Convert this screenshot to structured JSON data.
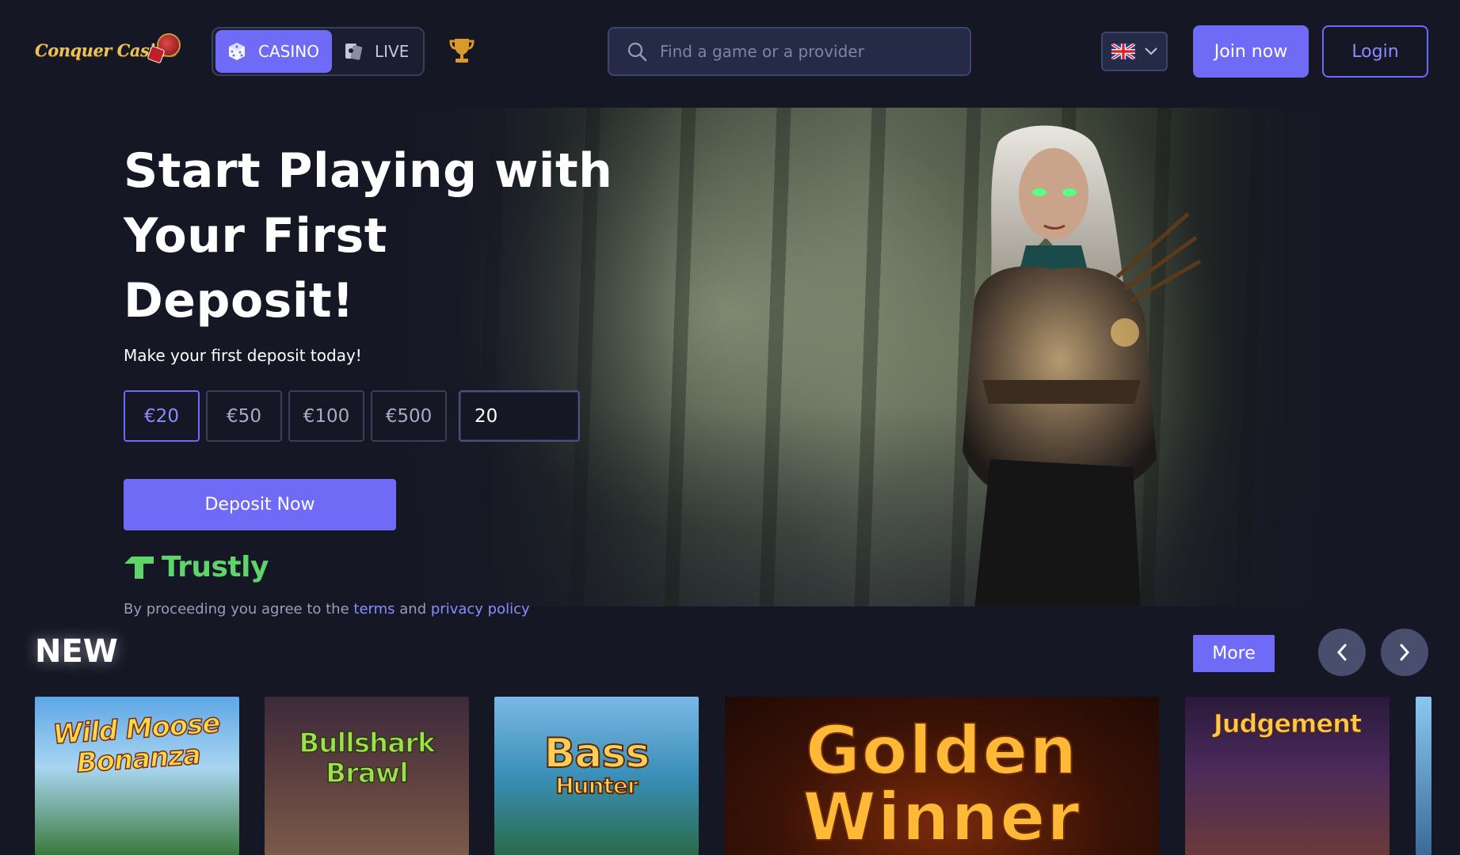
{
  "header": {
    "logo_text": "Conquer Casino",
    "mode_tabs": [
      {
        "label": "CASINO",
        "icon": "dice-icon",
        "active": true
      },
      {
        "label": "LIVE",
        "icon": "cards-icon",
        "active": false
      }
    ],
    "trophy_icon": "trophy-icon",
    "search": {
      "placeholder": "Find a game or a provider",
      "icon": "search-icon"
    },
    "language": {
      "flag": "uk-flag-icon",
      "icon": "chevron-down-icon"
    },
    "join_label": "Join now",
    "login_label": "Login"
  },
  "hero": {
    "title_line1": "Start Playing with",
    "title_line2": "Your First Deposit!",
    "subtitle": "Make your first deposit today!",
    "amounts": [
      "€20",
      "€50",
      "€100",
      "€500"
    ],
    "selected_amount": "€20",
    "amount_value": "20",
    "deposit_label": "Deposit Now",
    "payment_provider": "Trustly",
    "legal": {
      "prefix": "By proceeding you agree to the",
      "terms_link": "terms",
      "conjunction": "and",
      "privacy_link": "privacy policy"
    }
  },
  "new_section": {
    "title": "NEW",
    "more_label": "More",
    "prev_icon": "chevron-left-icon",
    "next_icon": "chevron-right-icon",
    "games": [
      {
        "title_line1": "Wild Moose",
        "title_line2": "Bonanza"
      },
      {
        "title_line1": "Bullshark",
        "title_line2": "Brawl"
      },
      {
        "title_line1": "Bass",
        "title_line2": "Hunter"
      },
      {
        "title_line1": "Golden",
        "title_line2": "Winner"
      },
      {
        "title_line1": "Judgement",
        "title_line2": ""
      }
    ]
  },
  "colors": {
    "background": "#151725",
    "accent": "#6f6bf6",
    "trustly_green": "#5fd46a"
  }
}
